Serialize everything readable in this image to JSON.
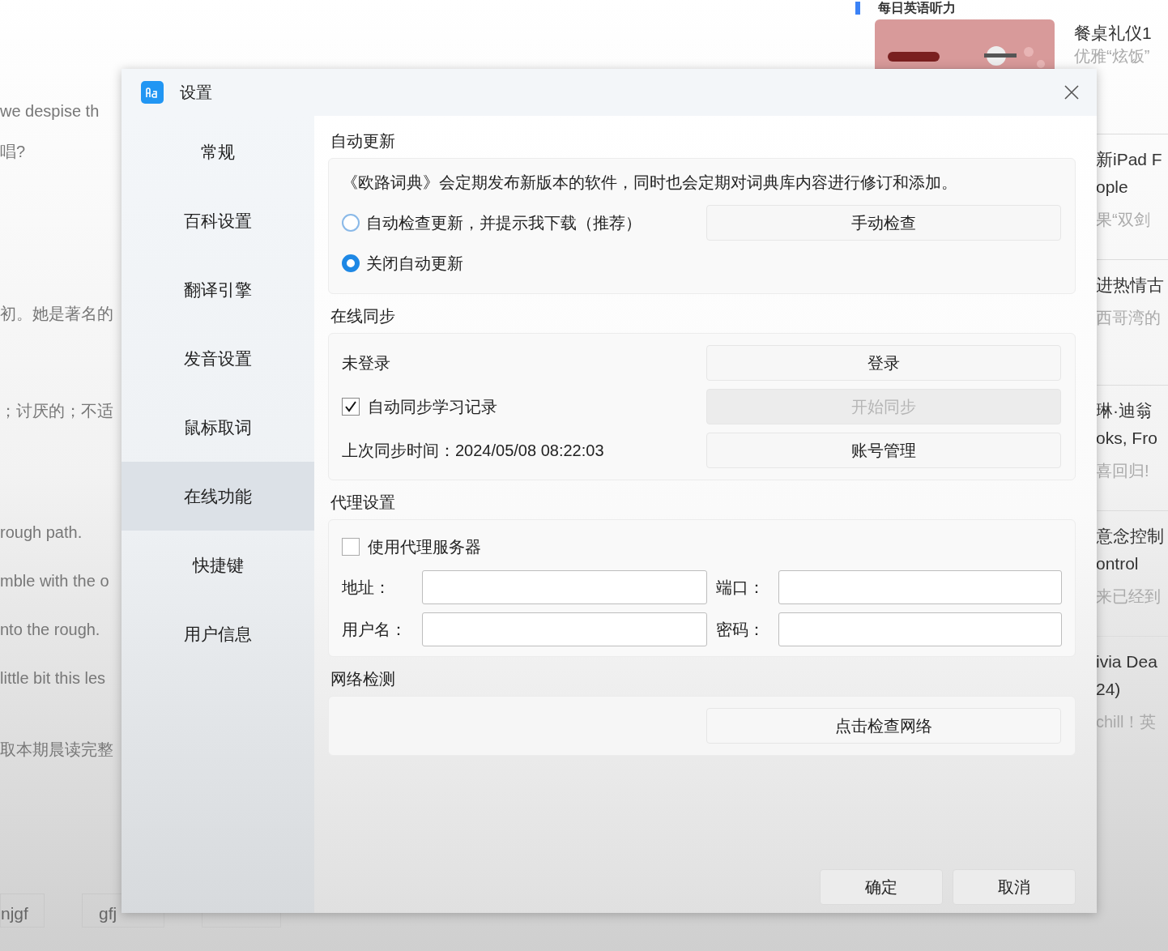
{
  "background": {
    "left_texts": [
      "we despise th",
      "唱?",
      "初。她是著名的",
      "；讨厌的；不适",
      "rough path.",
      "mble with the o",
      "nto the rough.",
      "little bit this les",
      "取本期晨读完整"
    ],
    "tags": [
      "njgf",
      "gfj"
    ],
    "heading": "每日英语听力",
    "articles": [
      {
        "lines": [
          "餐桌礼仪1"
        ],
        "subtitle": "优雅“炫饭”",
        "has_picture": true
      },
      {
        "lines": [
          "新iPad F",
          "ople"
        ],
        "subtitle": "果“双剑",
        "has_picture": false
      },
      {
        "lines": [
          "进热情古"
        ],
        "subtitle": "西哥湾的",
        "has_picture": false
      },
      {
        "lines": [
          "琳·迪翁",
          "oks, Fro"
        ],
        "subtitle": "喜回归!",
        "has_picture": false
      },
      {
        "lines": [
          "意念控制",
          "ontrol"
        ],
        "subtitle": "来已经到",
        "has_picture": false
      },
      {
        "lines": [
          "ivia Dea",
          "24)"
        ],
        "subtitle": "chill！英",
        "has_picture": false
      }
    ]
  },
  "dialog": {
    "title": "设置",
    "nav": [
      {
        "label": "常规",
        "selected": false
      },
      {
        "label": "百科设置",
        "selected": false
      },
      {
        "label": "翻译引擎",
        "selected": false
      },
      {
        "label": "发音设置",
        "selected": false
      },
      {
        "label": "鼠标取词",
        "selected": false
      },
      {
        "label": "在线功能",
        "selected": true
      },
      {
        "label": "快捷键",
        "selected": false
      },
      {
        "label": "用户信息",
        "selected": false
      }
    ],
    "update": {
      "title": "自动更新",
      "description": "《欧路词典》会定期发布新版本的软件，同时也会定期对词典库内容进行修订和添加。",
      "options": [
        {
          "label": "自动检查更新，并提示我下载（推荐）",
          "selected": false
        },
        {
          "label": "关闭自动更新",
          "selected": true
        }
      ],
      "button": "手动检查"
    },
    "sync": {
      "title": "在线同步",
      "status": "未登录",
      "login_button": "登录",
      "auto_sync": {
        "label": "自动同步学习记录",
        "checked": true
      },
      "start_button": {
        "label": "开始同步",
        "disabled": true
      },
      "last_sync": "上次同步时间：2024/05/08 08:22:03",
      "account_button": "账号管理"
    },
    "proxy": {
      "title": "代理设置",
      "use_proxy": {
        "label": "使用代理服务器",
        "checked": false
      },
      "fields": [
        {
          "label": "地址："
        },
        {
          "label": "端口："
        },
        {
          "label": "用户名："
        },
        {
          "label": "密码："
        }
      ]
    },
    "network": {
      "title": "网络检测",
      "button": "点击检查网络"
    },
    "footer_buttons": [
      "确定",
      "取消"
    ]
  }
}
